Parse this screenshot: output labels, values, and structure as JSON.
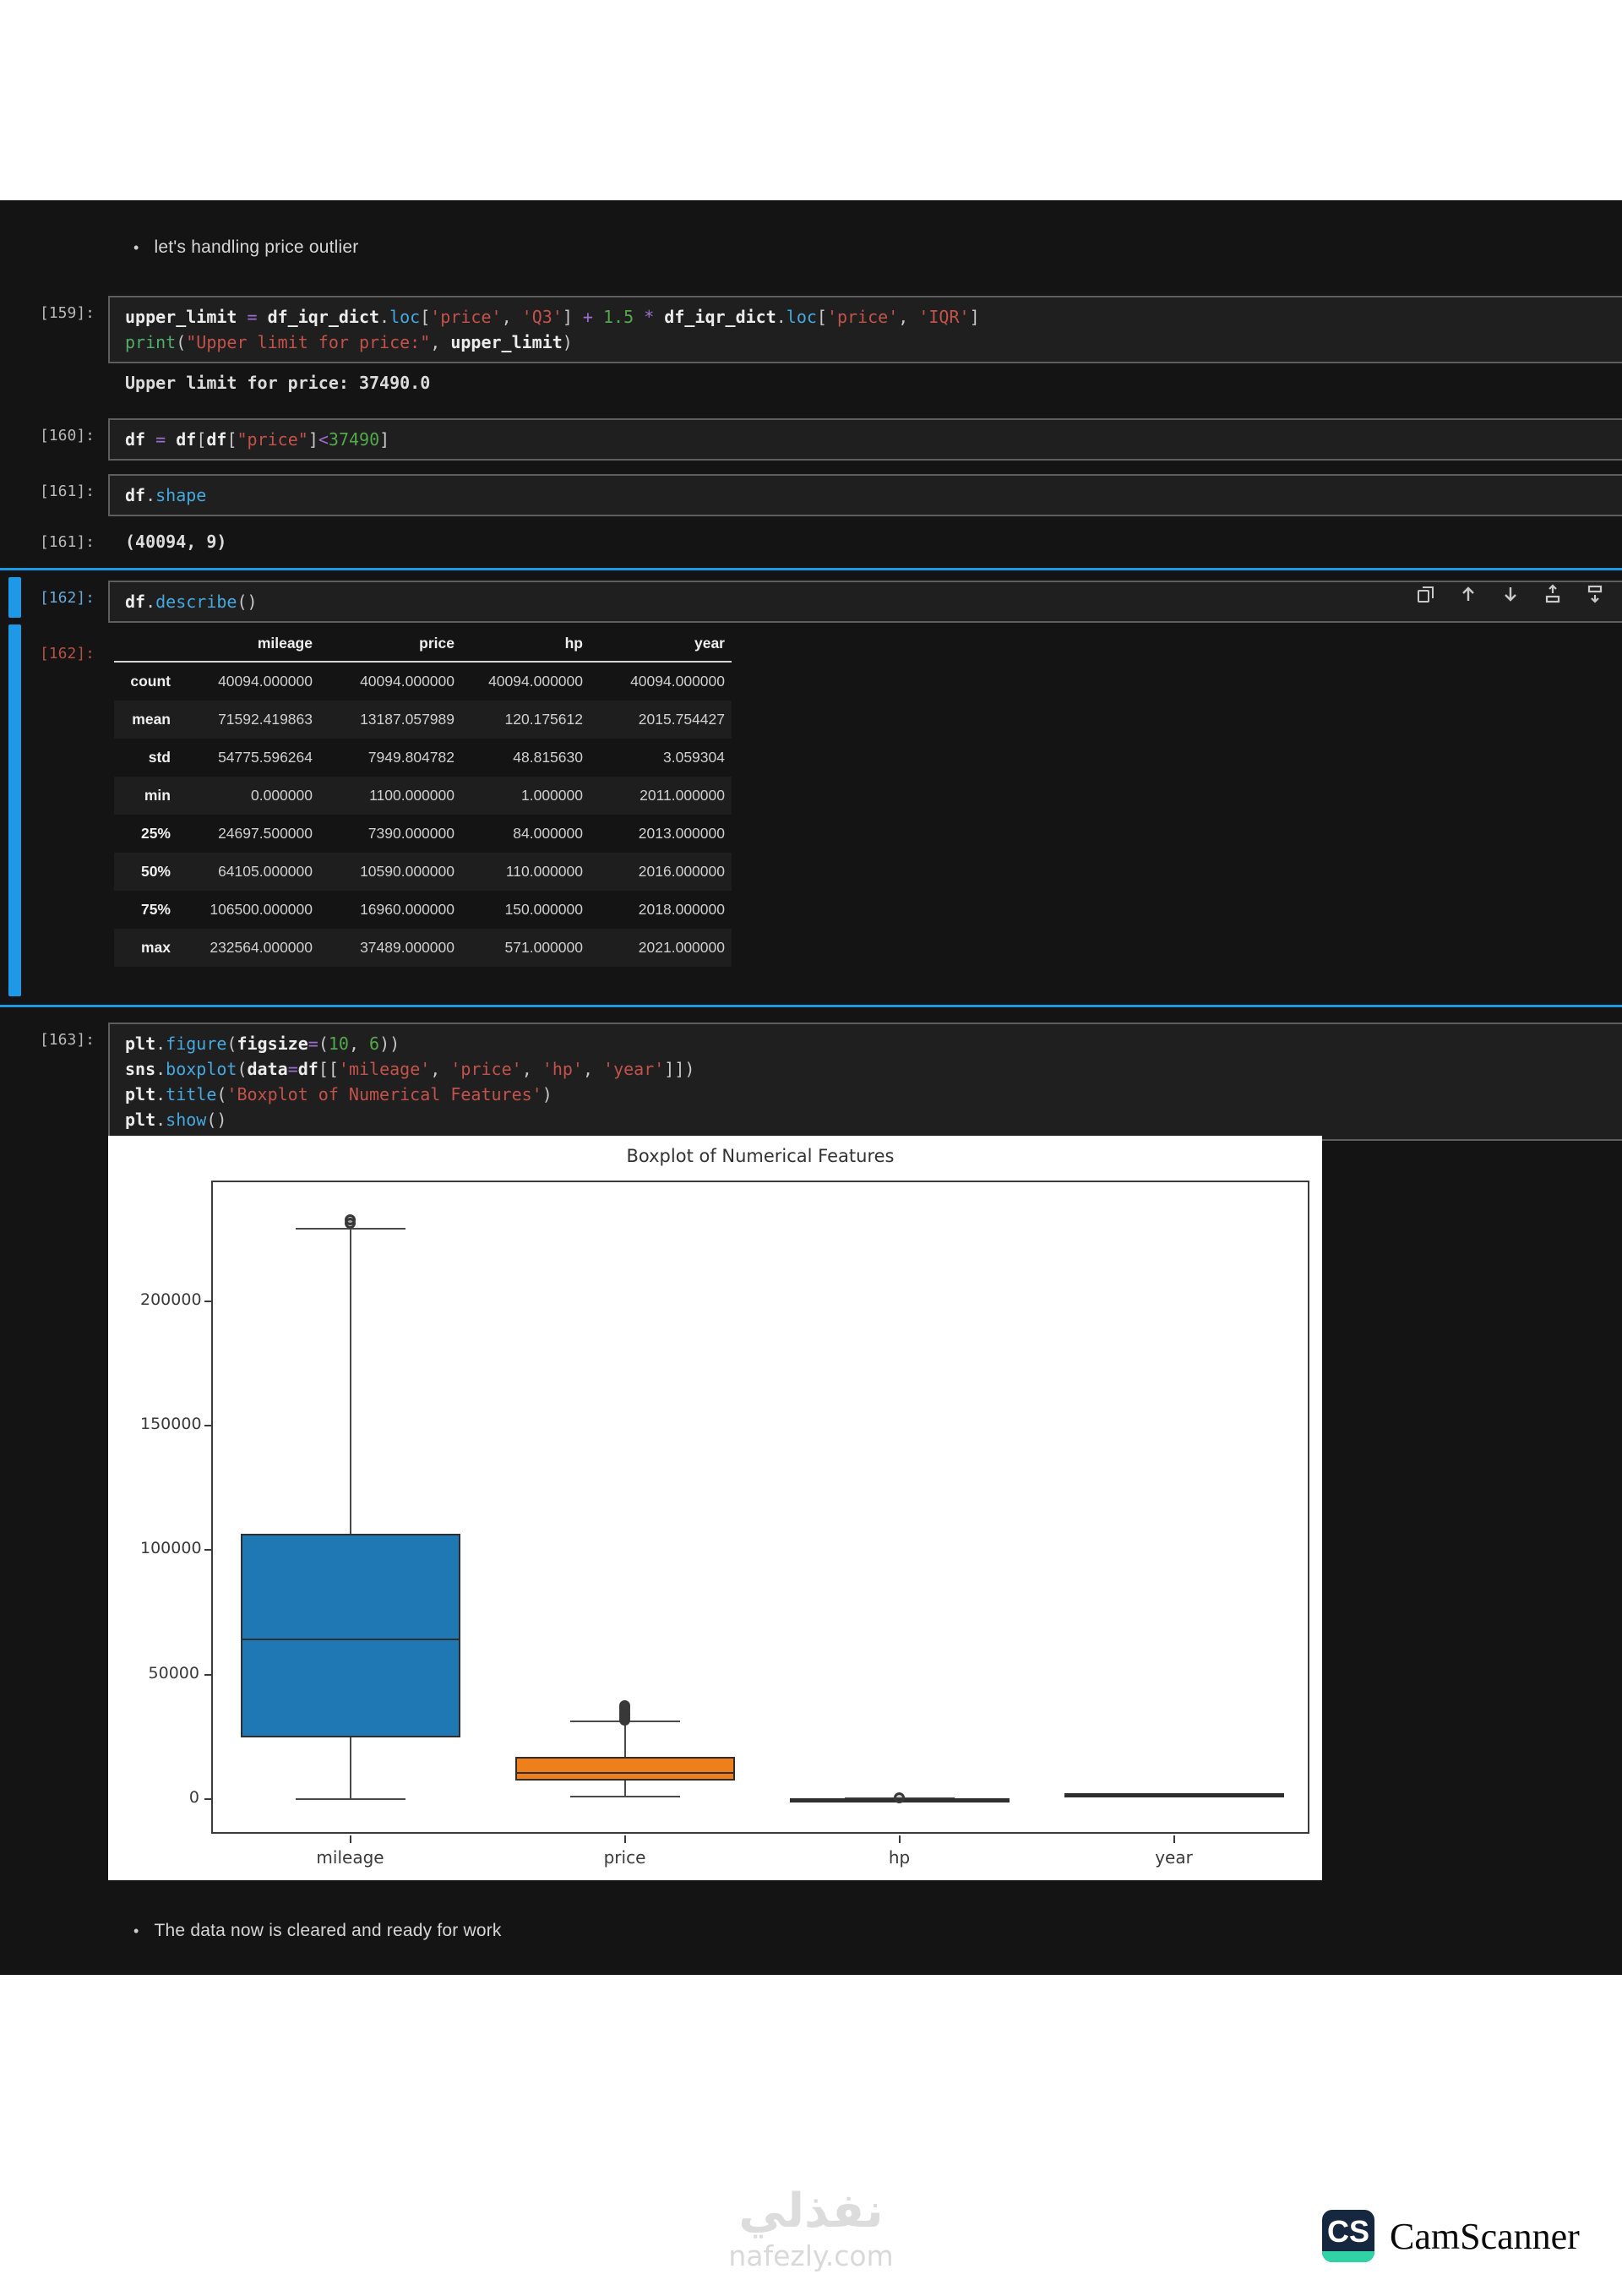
{
  "markdown": {
    "top_note": "let's handling price outlier",
    "bottom_note": "The data now is cleared and ready for work"
  },
  "cells": {
    "c159": {
      "prompt": "[159]:",
      "lines": [
        [
          [
            "v",
            "upper_limit"
          ],
          [
            "p",
            " "
          ],
          [
            "o",
            "="
          ],
          [
            "p",
            " "
          ],
          [
            "v",
            "df_iqr_dict"
          ],
          [
            "p",
            "."
          ],
          [
            "m",
            "loc"
          ],
          [
            "p",
            "["
          ],
          [
            "s",
            "'price'"
          ],
          [
            "p",
            ", "
          ],
          [
            "s",
            "'Q3'"
          ],
          [
            "p",
            "] "
          ],
          [
            "o",
            "+"
          ],
          [
            "p",
            " "
          ],
          [
            "n",
            "1.5"
          ],
          [
            "p",
            " "
          ],
          [
            "o",
            "*"
          ],
          [
            "p",
            " "
          ],
          [
            "v",
            "df_iqr_dict"
          ],
          [
            "p",
            "."
          ],
          [
            "m",
            "loc"
          ],
          [
            "p",
            "["
          ],
          [
            "s",
            "'price'"
          ],
          [
            "p",
            ", "
          ],
          [
            "s",
            "'IQR'"
          ],
          [
            "p",
            "]"
          ]
        ],
        [
          [
            "f",
            "print"
          ],
          [
            "p",
            "("
          ],
          [
            "s",
            "\"Upper limit for price:\""
          ],
          [
            "p",
            ", "
          ],
          [
            "v",
            "upper_limit"
          ],
          [
            "p",
            ")"
          ]
        ]
      ]
    },
    "out159": {
      "text": "Upper limit for price: 37490.0"
    },
    "c160": {
      "prompt": "[160]:",
      "lines": [
        [
          [
            "v",
            "df"
          ],
          [
            "p",
            " "
          ],
          [
            "o",
            "="
          ],
          [
            "p",
            " "
          ],
          [
            "v",
            "df"
          ],
          [
            "p",
            "["
          ],
          [
            "v",
            "df"
          ],
          [
            "p",
            "["
          ],
          [
            "s",
            "\"price\""
          ],
          [
            "p",
            "]"
          ],
          [
            "o",
            "<"
          ],
          [
            "n",
            "37490"
          ],
          [
            "p",
            "]"
          ]
        ]
      ]
    },
    "c161": {
      "prompt": "[161]:",
      "lines": [
        [
          [
            "v",
            "df"
          ],
          [
            "p",
            "."
          ],
          [
            "m",
            "shape"
          ]
        ]
      ]
    },
    "out161": {
      "prompt": "[161]:",
      "text": "(40094, 9)"
    },
    "c162": {
      "prompt": "[162]:",
      "lines": [
        [
          [
            "v",
            "df"
          ],
          [
            "p",
            "."
          ],
          [
            "m",
            "describe"
          ],
          [
            "p",
            "()"
          ]
        ]
      ]
    },
    "out162": {
      "prompt": "[162]:"
    },
    "c163": {
      "prompt": "[163]:",
      "lines": [
        [
          [
            "v",
            "plt"
          ],
          [
            "p",
            "."
          ],
          [
            "m",
            "figure"
          ],
          [
            "p",
            "("
          ],
          [
            "v",
            "figsize"
          ],
          [
            "o",
            "="
          ],
          [
            "p",
            "("
          ],
          [
            "n",
            "10"
          ],
          [
            "p",
            ", "
          ],
          [
            "n",
            "6"
          ],
          [
            "p",
            "))"
          ]
        ],
        [
          [
            "v",
            "sns"
          ],
          [
            "p",
            "."
          ],
          [
            "m",
            "boxplot"
          ],
          [
            "p",
            "("
          ],
          [
            "v",
            "data"
          ],
          [
            "o",
            "="
          ],
          [
            "v",
            "df"
          ],
          [
            "p",
            "[["
          ],
          [
            "s",
            "'mileage'"
          ],
          [
            "p",
            ", "
          ],
          [
            "s",
            "'price'"
          ],
          [
            "p",
            ", "
          ],
          [
            "s",
            "'hp'"
          ],
          [
            "p",
            ", "
          ],
          [
            "s",
            "'year'"
          ],
          [
            "p",
            "]])"
          ]
        ],
        [
          [
            "v",
            "plt"
          ],
          [
            "p",
            "."
          ],
          [
            "m",
            "title"
          ],
          [
            "p",
            "("
          ],
          [
            "s",
            "'Boxplot of Numerical Features'"
          ],
          [
            "p",
            ")"
          ]
        ],
        [
          [
            "v",
            "plt"
          ],
          [
            "p",
            "."
          ],
          [
            "m",
            "show"
          ],
          [
            "p",
            "()"
          ]
        ]
      ]
    }
  },
  "describe_table": {
    "headers": [
      "mileage",
      "price",
      "hp",
      "year"
    ],
    "rows": [
      {
        "label": "count",
        "values": [
          "40094.000000",
          "40094.000000",
          "40094.000000",
          "40094.000000"
        ]
      },
      {
        "label": "mean",
        "values": [
          "71592.419863",
          "13187.057989",
          "120.175612",
          "2015.754427"
        ]
      },
      {
        "label": "std",
        "values": [
          "54775.596264",
          "7949.804782",
          "48.815630",
          "3.059304"
        ]
      },
      {
        "label": "min",
        "values": [
          "0.000000",
          "1100.000000",
          "1.000000",
          "2011.000000"
        ]
      },
      {
        "label": "25%",
        "values": [
          "24697.500000",
          "7390.000000",
          "84.000000",
          "2013.000000"
        ]
      },
      {
        "label": "50%",
        "values": [
          "64105.000000",
          "10590.000000",
          "110.000000",
          "2016.000000"
        ]
      },
      {
        "label": "75%",
        "values": [
          "106500.000000",
          "16960.000000",
          "150.000000",
          "2018.000000"
        ]
      },
      {
        "label": "max",
        "values": [
          "232564.000000",
          "37489.000000",
          "571.000000",
          "2021.000000"
        ]
      }
    ]
  },
  "chart_data": {
    "type": "boxplot",
    "title": "Boxplot of Numerical Features",
    "categories": [
      "mileage",
      "price",
      "hp",
      "year"
    ],
    "y_ticks": [
      0,
      50000,
      100000,
      150000,
      200000
    ],
    "ylim": [
      -14600,
      247800
    ],
    "grid": false,
    "legend": "none",
    "series": [
      {
        "name": "mileage",
        "whisker_low": 0,
        "q1": 24697.5,
        "median": 64105,
        "q3": 106500,
        "whisker_high": 229204,
        "fliers": [
          231500,
          232564
        ],
        "color": "#1f77b4"
      },
      {
        "name": "price",
        "whisker_low": 1100,
        "q1": 7390,
        "median": 10590,
        "q3": 16960,
        "whisker_high": 31315,
        "fliers": [
          31900,
          32800,
          33700,
          34600,
          35500,
          36400,
          37489
        ],
        "color": "#ef7f1a"
      },
      {
        "name": "hp",
        "whisker_low": 1,
        "q1": 84,
        "median": 110,
        "q3": 150,
        "whisker_high": 249,
        "fliers": [
          571
        ],
        "color": "#2ca02c"
      },
      {
        "name": "year",
        "whisker_low": 2011,
        "q1": 2013,
        "median": 2016,
        "q3": 2018,
        "whisker_high": 2021,
        "fliers": [],
        "color": "#d62728"
      }
    ]
  },
  "toolbar": {
    "icons": [
      "duplicate-cell",
      "move-cell-up",
      "move-cell-down",
      "insert-cell-above",
      "insert-cell-below"
    ]
  },
  "watermark": {
    "logo": "نفذلي",
    "site": "nafezly.com"
  },
  "camscanner": {
    "badge": "CS",
    "label": "CamScanner"
  },
  "colors": {
    "selection_blue": "#1d99e8",
    "notebook_bg": "#141414",
    "cell_bg": "#1f1f1f",
    "box_mileage": "#1f77b4",
    "box_price": "#ef7f1a",
    "camscanner_navy": "#16283f",
    "camscanner_teal": "#2fd3a5"
  }
}
